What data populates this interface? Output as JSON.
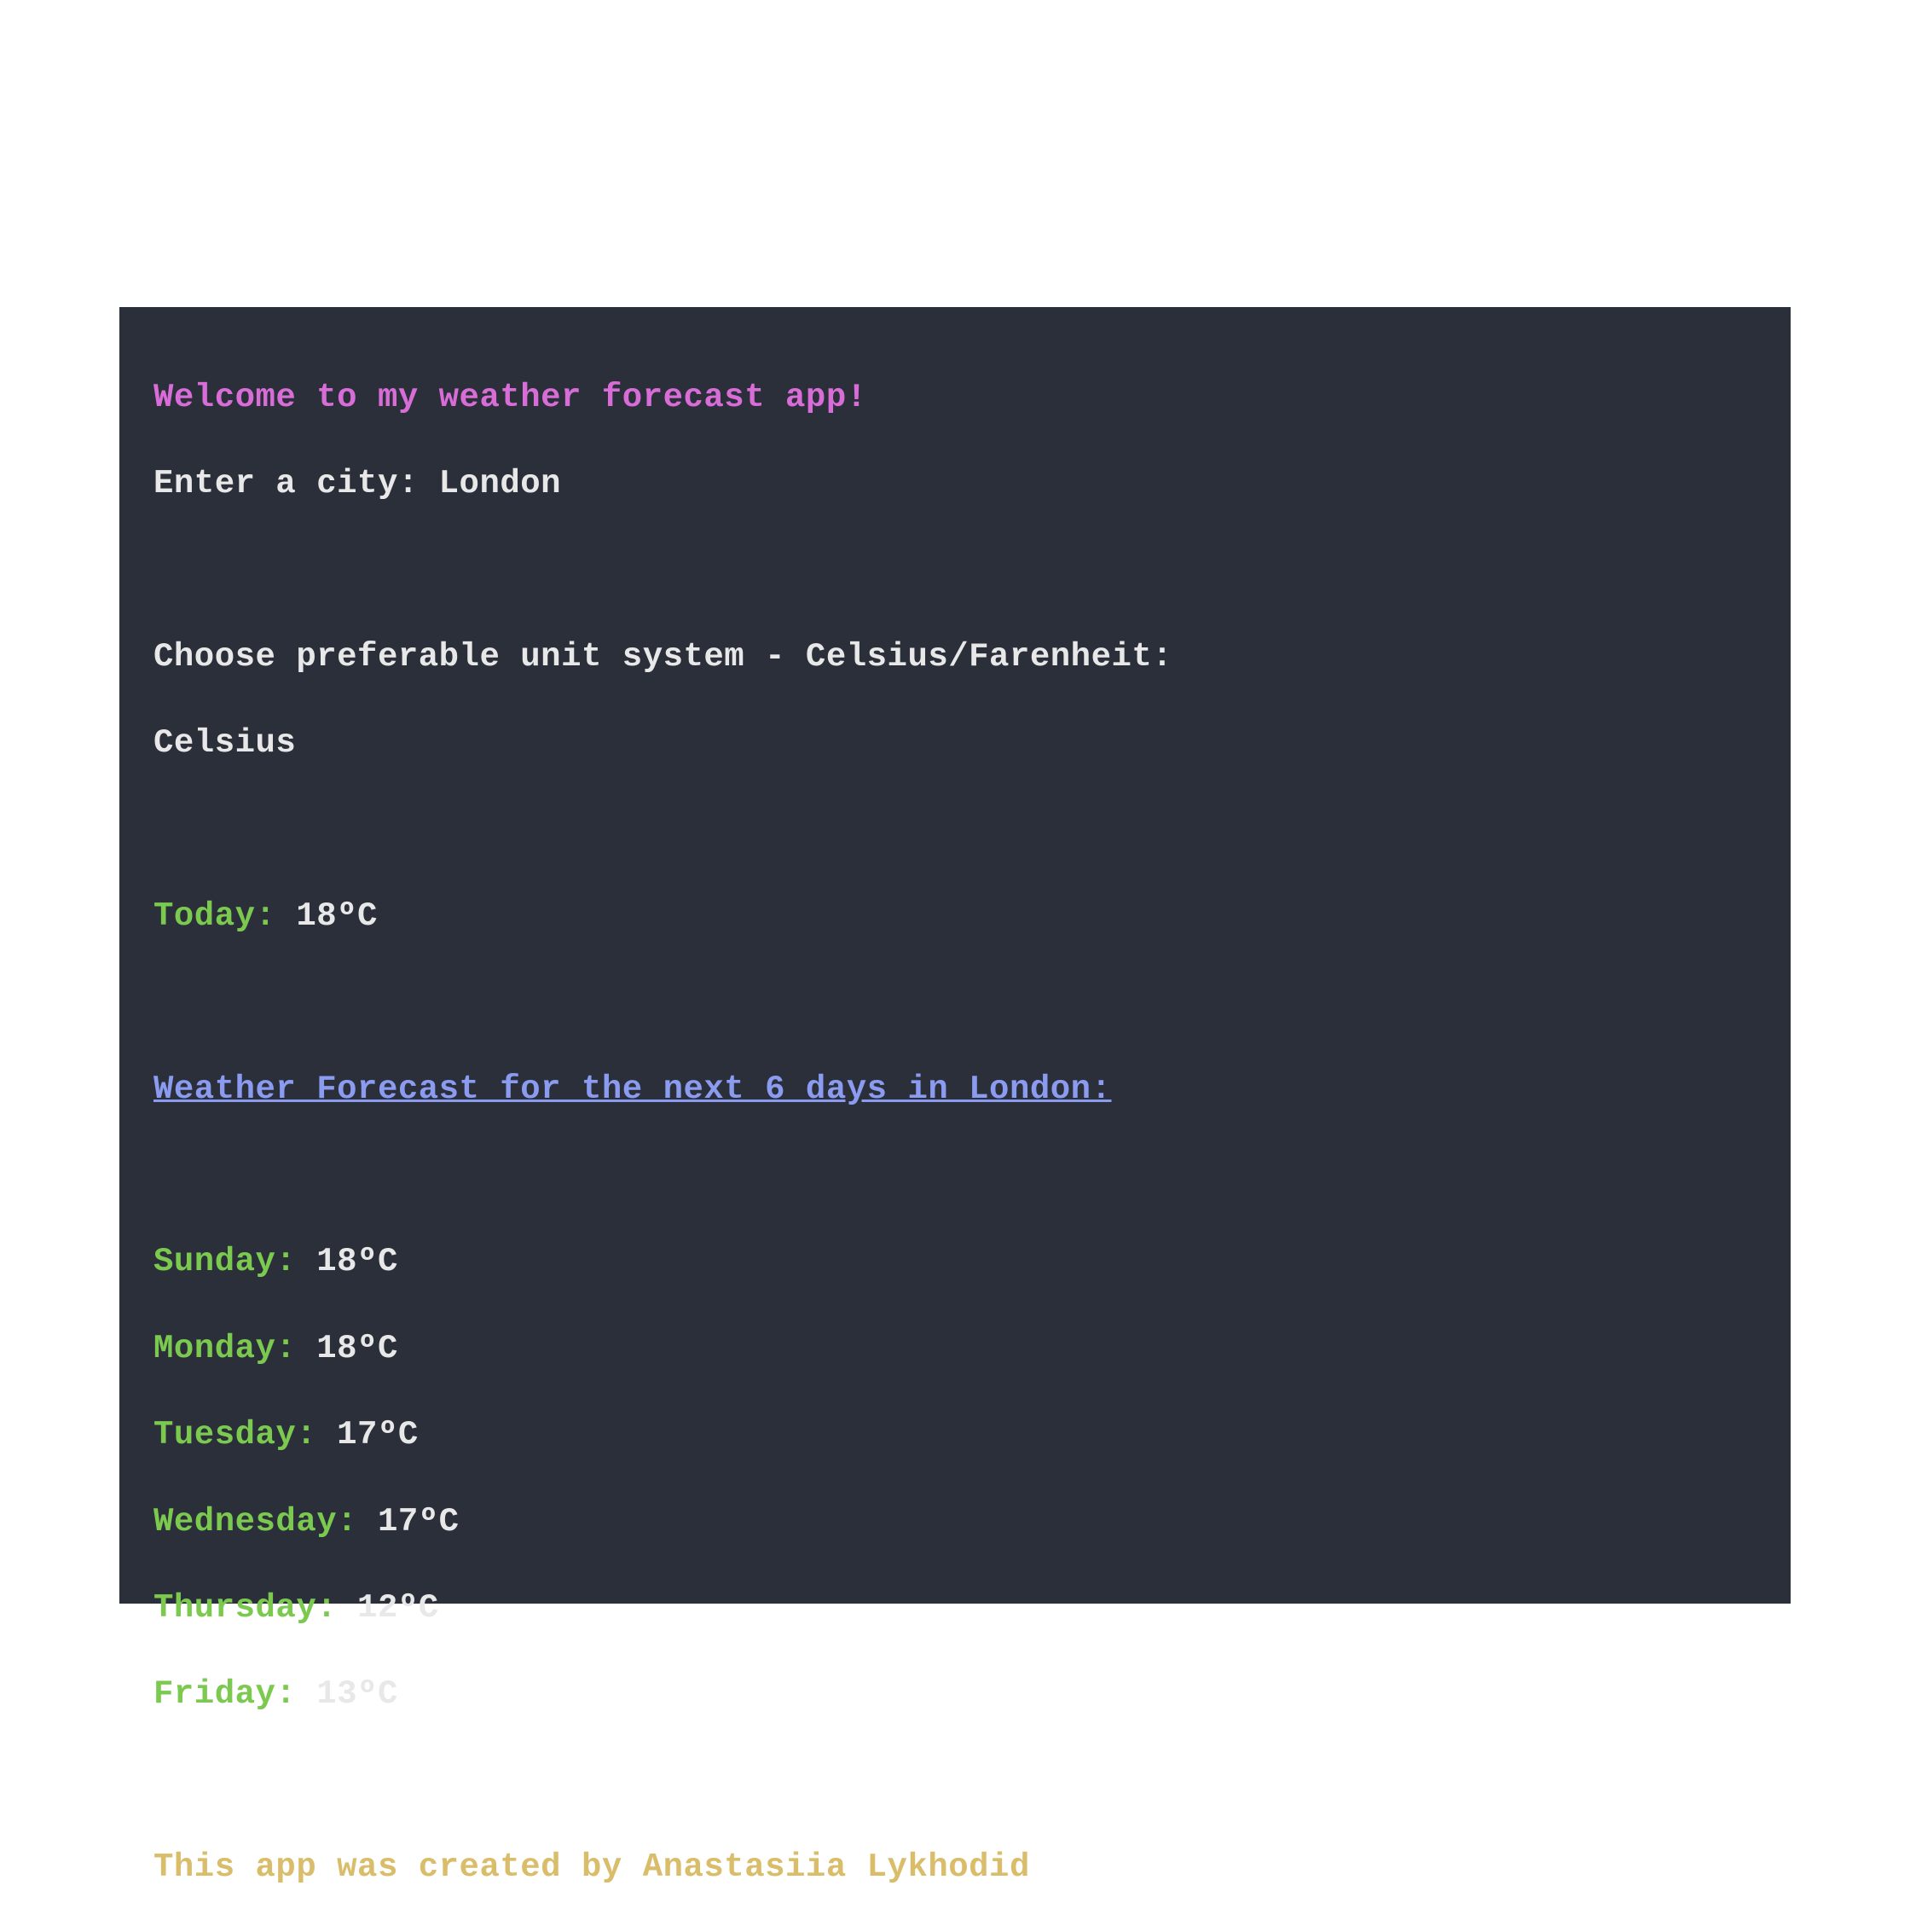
{
  "welcome": "Welcome to my weather forecast app!",
  "prompt_city_label": "Enter a city: ",
  "city_input": "London",
  "prompt_unit": "Choose preferable unit system - Celsius/Farenheit:",
  "unit_input": "Celsius",
  "today_label": "Today: ",
  "today_value": "18ºC",
  "forecast_header": "Weather Forecast for the next 6 days in London:",
  "forecast": [
    {
      "day_label": "Sunday: ",
      "temp": "18ºC"
    },
    {
      "day_label": "Monday: ",
      "temp": "18ºC"
    },
    {
      "day_label": "Tuesday: ",
      "temp": "17ºC"
    },
    {
      "day_label": "Wednesday: ",
      "temp": "17ºC"
    },
    {
      "day_label": "Thursday: ",
      "temp": "12ºC"
    },
    {
      "day_label": "Friday: ",
      "temp": "13ºC"
    }
  ],
  "credit": "This app was created by Anastasiia Lykhodid"
}
